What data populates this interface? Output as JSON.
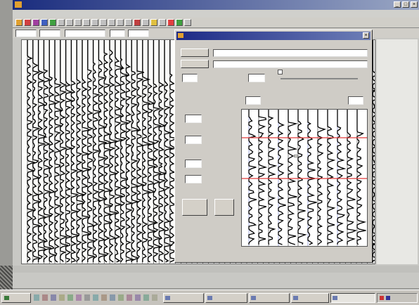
{
  "app": {
    "title": "",
    "menu": [
      "",
      "",
      "",
      "",
      "",
      "",
      "",
      "",
      ""
    ],
    "toolbar_icons": [
      "app-icon",
      "open-icon",
      "save-icon",
      "print-icon",
      "cut-icon",
      "copy-icon",
      "paste-icon",
      "select-icon",
      "move-icon",
      "zoom-in-icon",
      "zoom-out-icon",
      "pan-icon",
      "scroll-icon",
      "refresh-icon",
      "settings-icon",
      "pick-icon",
      "color-icon",
      "trace-icon",
      "flag-icon",
      "delete-icon",
      "help-icon"
    ],
    "controls": {
      "field1": "",
      "field2": "",
      "mode": "",
      "field3": "",
      "field4": ""
    },
    "right_ruler_ticks": [
      "",
      "",
      "",
      "",
      ""
    ]
  },
  "dialog": {
    "title": "",
    "header_text": "",
    "input_file_button": "",
    "input_file_path": "",
    "output_file_button": "",
    "output_file_path": "",
    "wavelet_value": "",
    "wavelet_label": "",
    "wavelet_value2": "",
    "check_label": "",
    "range_min": "",
    "range_max": "",
    "plot_header": "",
    "plot_min": "",
    "plot_max": "",
    "start_value": "",
    "start_label": "",
    "section_label": "",
    "end_value": "",
    "end_label": "",
    "gap_value": "",
    "gap_label": "",
    "length_value": "",
    "length_label": "",
    "horizon_label": "",
    "run_button": "",
    "exit_button": ""
  },
  "taskbar": {
    "start": "",
    "tasks": [
      {
        "label": "",
        "active": false
      },
      {
        "label": "",
        "active": false
      },
      {
        "label": "",
        "active": false
      },
      {
        "label": "",
        "active": false
      },
      {
        "label": "",
        "active": true
      }
    ],
    "clock": ""
  },
  "colors": {
    "title_blue": "#1a2c7e",
    "horizon_red": "#e23a3a",
    "trace_blue": "#6b77c9",
    "trace_black": "#000000"
  }
}
